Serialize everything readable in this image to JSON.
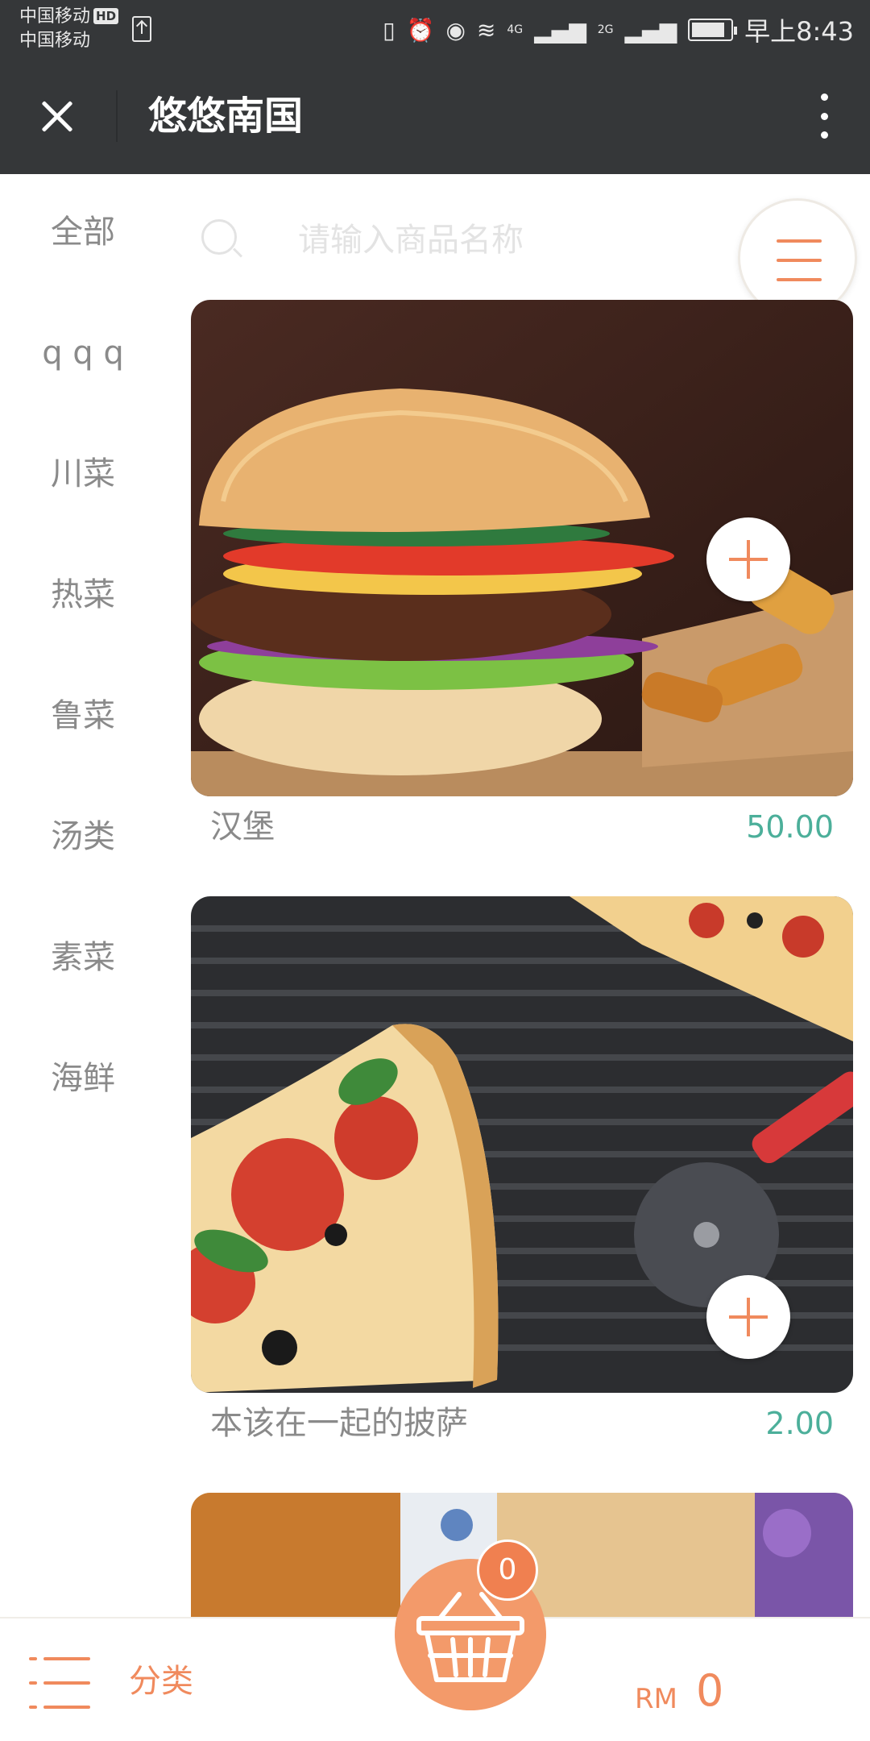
{
  "status_bar": {
    "carrier_1": "中国移动",
    "hd": "HD",
    "carrier_2": "中国移动",
    "network_4g": "4G",
    "network_2g": "2G",
    "time": "早上8:43"
  },
  "app_bar": {
    "title": "悠悠南国"
  },
  "sidebar": {
    "items": [
      {
        "label": "全部"
      },
      {
        "label": "q q q"
      },
      {
        "label": "川菜"
      },
      {
        "label": "热菜"
      },
      {
        "label": "鲁菜"
      },
      {
        "label": "汤类"
      },
      {
        "label": "素菜"
      },
      {
        "label": "海鲜"
      }
    ]
  },
  "search": {
    "placeholder": "请输入商品名称"
  },
  "products": [
    {
      "name": "汉堡",
      "price": "50.00"
    },
    {
      "name": "本该在一起的披萨",
      "price": "2.00"
    }
  ],
  "bottom_bar": {
    "category_label": "分类",
    "currency": "RM",
    "total": "0",
    "cart_count": "0"
  },
  "colors": {
    "accent": "#f08a5d",
    "price": "#4caf9a",
    "header": "#353739"
  }
}
